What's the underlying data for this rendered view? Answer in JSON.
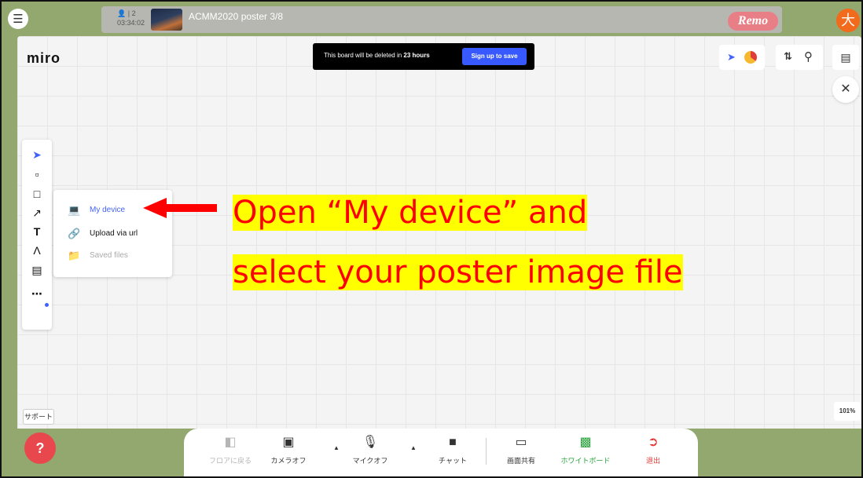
{
  "remo_bar": {
    "participant_count": "2",
    "elapsed_time": "03:34:02",
    "board_title": "ACMM2020 poster 3/8",
    "brand_logo": "Remo",
    "user_avatar": "大",
    "accent_color": "#93a86f"
  },
  "miro": {
    "logo": "miro",
    "notice": {
      "prefix": "This board will be deleted in",
      "hours": "23 hours",
      "button": "Sign up to save"
    },
    "zoom_level": "101%"
  },
  "toolbar": {
    "tools": [
      "select-icon",
      "sticky-note-icon",
      "shape-icon",
      "arrow-icon",
      "text-icon",
      "pen-icon",
      "comment-icon",
      "more-icon"
    ],
    "more_has_dot": true
  },
  "upload_menu": {
    "items": [
      {
        "label": "My device",
        "icon": "laptop-icon",
        "state": "highlighted"
      },
      {
        "label": "Upload via url",
        "icon": "link-icon",
        "state": "normal"
      },
      {
        "label": "Saved files",
        "icon": "folder-icon",
        "state": "disabled"
      }
    ]
  },
  "annotation": {
    "line1": "Open “My device” and",
    "line2": "select your poster image file",
    "color": "#ff0000",
    "highlight": "#ffff00"
  },
  "support": {
    "label": "サポート"
  },
  "bottom_bar": {
    "items": [
      {
        "label": "フロアに戻る",
        "icon": "map-icon"
      },
      {
        "label": "カメラオフ",
        "icon": "camera-off-icon"
      },
      {
        "label": "マイクオフ",
        "icon": "mic-off-icon"
      },
      {
        "label": "チャット",
        "icon": "chat-icon"
      },
      {
        "label": "画面共有",
        "icon": "screen-share-icon"
      },
      {
        "label": "ホワイトボード",
        "icon": "whiteboard-icon"
      },
      {
        "label": "退出",
        "icon": "exit-icon"
      }
    ]
  }
}
